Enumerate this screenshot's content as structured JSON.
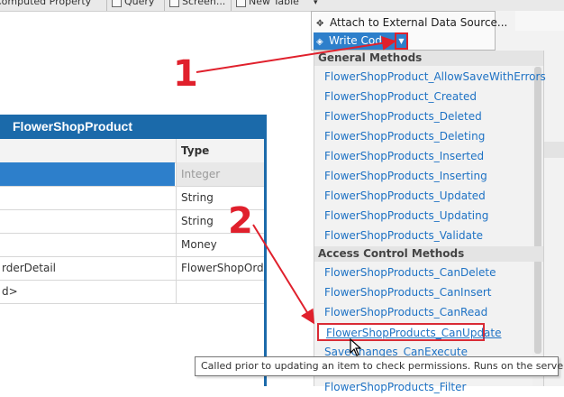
{
  "toolbar": {
    "items": [
      {
        "label": "Computed Property",
        "icon": "computed-property-icon"
      },
      {
        "label": "Query",
        "icon": "query-icon"
      },
      {
        "label": "Screen...",
        "icon": "screen-icon"
      },
      {
        "label": "New Table",
        "icon": "new-table-icon"
      }
    ]
  },
  "entity": {
    "title": "FlowerShopProduct",
    "column_headers": {
      "name": "",
      "type": "Type"
    },
    "rows": [
      {
        "name": "",
        "type": "Integer"
      },
      {
        "name": "",
        "type": "String"
      },
      {
        "name": "",
        "type": "String"
      },
      {
        "name": "",
        "type": "Money"
      },
      {
        "name": "rderDetail",
        "type": "FlowerShopOrder"
      },
      {
        "name": "d>",
        "type": ""
      }
    ]
  },
  "popup": {
    "attach_label": "Attach to External Data Source...",
    "write_code_label": "Write Code"
  },
  "methods": {
    "general_header": "General Methods",
    "general_items": [
      "FlowerShopProduct_AllowSaveWithErrors",
      "FlowerShopProduct_Created",
      "FlowerShopProducts_Deleted",
      "FlowerShopProducts_Deleting",
      "FlowerShopProducts_Inserted",
      "FlowerShopProducts_Inserting",
      "FlowerShopProducts_Updated",
      "FlowerShopProducts_Updating",
      "FlowerShopProducts_Validate"
    ],
    "access_header": "Access Control Methods",
    "access_items": [
      "FlowerShopProducts_CanDelete",
      "FlowerShopProducts_CanInsert",
      "FlowerShopProducts_CanRead",
      "FlowerShopProducts_CanUpdate",
      "SaveChanges_CanExecute"
    ],
    "partial_item": "FlowerShopProducts_Filter"
  },
  "tooltip": "Called prior to updating an item to check permissions.  Runs on the server.",
  "annotations": {
    "step1": "1",
    "step2": "2"
  },
  "colors": {
    "accent": "#2d7fcb",
    "header": "#1b6aaa",
    "link": "#1e72c4",
    "annotation": "#e0202c"
  }
}
